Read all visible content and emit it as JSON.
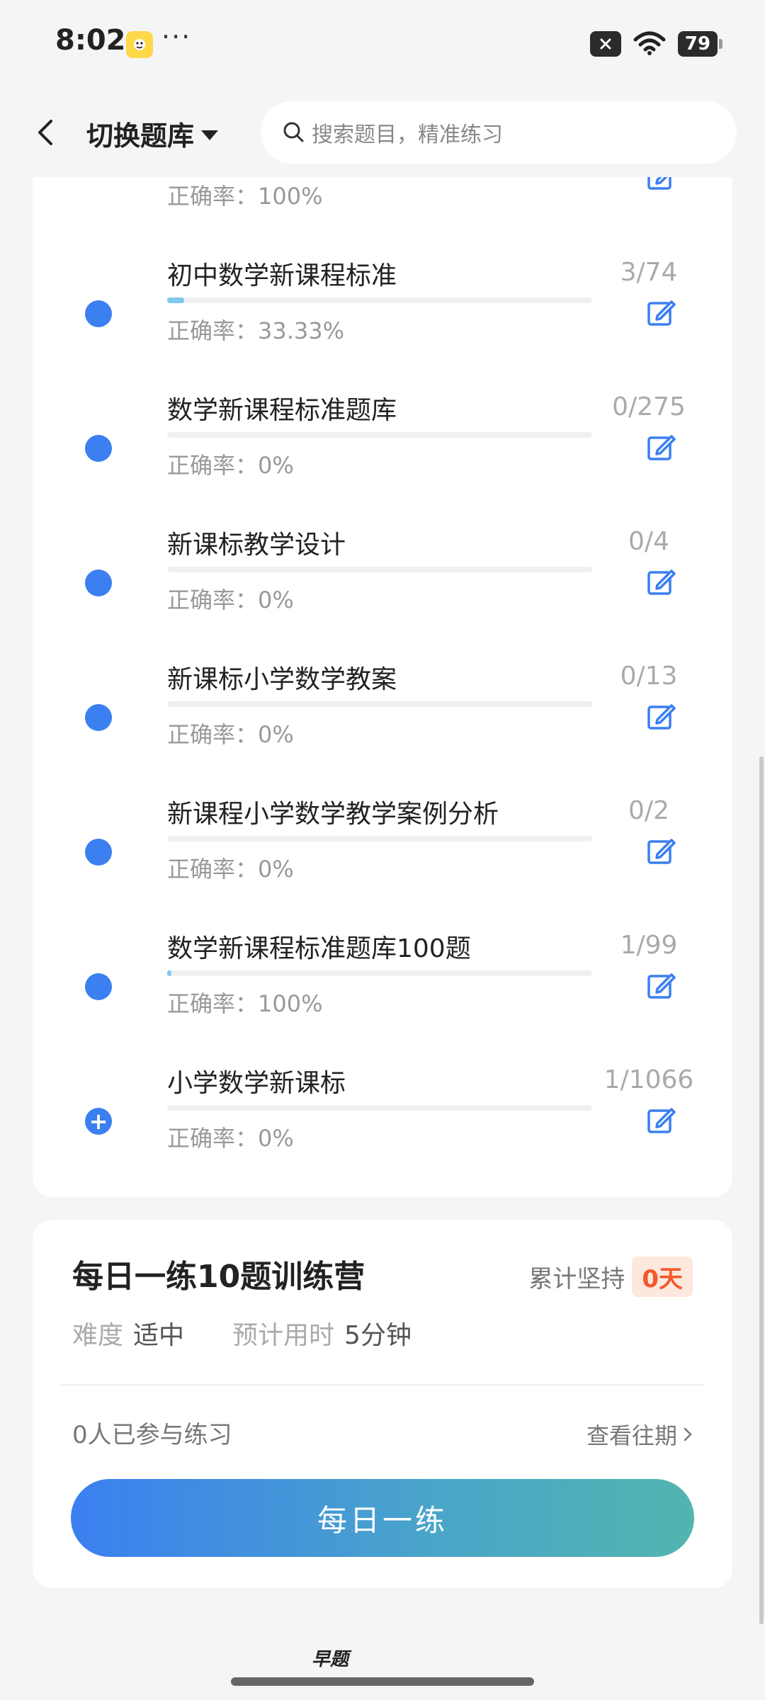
{
  "status_bar": {
    "time": "8:02",
    "dots": "···",
    "battery": "79"
  },
  "header": {
    "switch_label": "切换题库",
    "search_placeholder": "搜索题目，精准练习"
  },
  "partial_row": {
    "accuracy": "正确率：100%"
  },
  "rows": [
    {
      "title": "初中数学新课程标准",
      "accuracy": "正确率：33.33%",
      "count": "3/74",
      "progress": 0.04
    },
    {
      "title": "数学新课程标准题库",
      "accuracy": "正确率：0%",
      "count": "0/275",
      "progress": 0
    },
    {
      "title": "新课标教学设计",
      "accuracy": "正确率：0%",
      "count": "0/4",
      "progress": 0
    },
    {
      "title": "新课标小学数学教案",
      "accuracy": "正确率：0%",
      "count": "0/13",
      "progress": 0
    },
    {
      "title": "新课程小学数学教学案例分析",
      "accuracy": "正确率：0%",
      "count": "0/2",
      "progress": 0
    },
    {
      "title": "数学新课程标准题库100题",
      "accuracy": "正确率：100%",
      "count": "1/99",
      "progress": 0.01
    },
    {
      "title": "小学数学新课标",
      "accuracy": "正确率：0%",
      "count": "1/1066",
      "progress": 0
    }
  ],
  "daily": {
    "title": "每日一练10题训练营",
    "persist_label": "累计坚持",
    "days": "0天",
    "difficulty_label": "难度",
    "difficulty_value": "适中",
    "time_label": "预计用时",
    "time_value": "5分钟",
    "joined": "0人已参与练习",
    "history": "查看往期",
    "button": "每日一练"
  },
  "brand": "早题",
  "colors": {
    "accent": "#3b7ff0",
    "badge_bg": "#fde8dd",
    "badge_text": "#f2592c"
  }
}
